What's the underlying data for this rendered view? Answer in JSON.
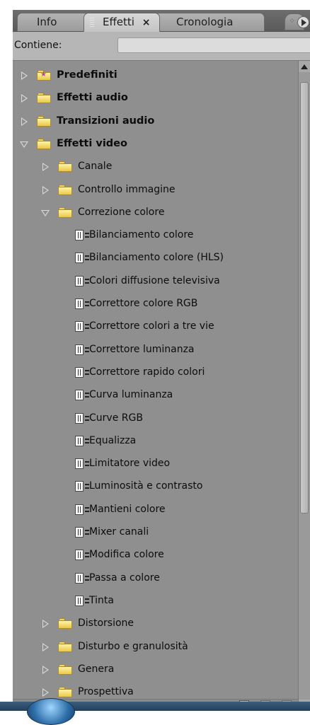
{
  "tabs": [
    {
      "label": "Info",
      "active": false
    },
    {
      "label": "Effetti",
      "active": true,
      "close": "×"
    },
    {
      "label": "Cronologia",
      "active": false
    }
  ],
  "search": {
    "label": "Contiene:",
    "value": ""
  },
  "tree": [
    {
      "label": "Predefiniti",
      "level": 0,
      "expander": "collapsed",
      "icon": "star-folder-icon",
      "bold": true
    },
    {
      "label": "Effetti audio",
      "level": 0,
      "expander": "collapsed",
      "icon": "folder-icon",
      "bold": true
    },
    {
      "label": "Transizioni audio",
      "level": 0,
      "expander": "collapsed",
      "icon": "folder-icon",
      "bold": true
    },
    {
      "label": "Effetti video",
      "level": 0,
      "expander": "expanded",
      "icon": "folder-icon",
      "bold": true
    },
    {
      "label": "Canale",
      "level": 1,
      "expander": "collapsed",
      "icon": "folder-icon"
    },
    {
      "label": "Controllo immagine",
      "level": 1,
      "expander": "collapsed",
      "icon": "folder-icon"
    },
    {
      "label": "Correzione colore",
      "level": 1,
      "expander": "expanded",
      "icon": "folder-icon"
    },
    {
      "label": "Bilanciamento colore",
      "level": 2,
      "icon": "effect-icon"
    },
    {
      "label": "Bilanciamento colore (HLS)",
      "level": 2,
      "icon": "effect-icon"
    },
    {
      "label": "Colori diffusione televisiva",
      "level": 2,
      "icon": "effect-icon"
    },
    {
      "label": "Correttore colore RGB",
      "level": 2,
      "icon": "effect-icon"
    },
    {
      "label": "Correttore colori a tre vie",
      "level": 2,
      "icon": "effect-icon"
    },
    {
      "label": "Correttore luminanza",
      "level": 2,
      "icon": "effect-icon"
    },
    {
      "label": "Correttore rapido colori",
      "level": 2,
      "icon": "effect-icon"
    },
    {
      "label": "Curva luminanza",
      "level": 2,
      "icon": "effect-icon"
    },
    {
      "label": "Curve RGB",
      "level": 2,
      "icon": "effect-icon"
    },
    {
      "label": "Equalizza",
      "level": 2,
      "icon": "effect-icon"
    },
    {
      "label": "Limitatore video",
      "level": 2,
      "icon": "effect-icon"
    },
    {
      "label": "Luminosità e contrasto",
      "level": 2,
      "icon": "effect-icon"
    },
    {
      "label": "Mantieni colore",
      "level": 2,
      "icon": "effect-icon"
    },
    {
      "label": "Mixer canali",
      "level": 2,
      "icon": "effect-icon"
    },
    {
      "label": "Modifica colore",
      "level": 2,
      "icon": "effect-icon"
    },
    {
      "label": "Passa a colore",
      "level": 2,
      "icon": "effect-icon"
    },
    {
      "label": "Tinta",
      "level": 2,
      "icon": "effect-icon"
    },
    {
      "label": "Distorsione",
      "level": 1,
      "expander": "collapsed",
      "icon": "folder-icon"
    },
    {
      "label": "Disturbo e granulosità",
      "level": 1,
      "expander": "collapsed",
      "icon": "folder-icon"
    },
    {
      "label": "Genera",
      "level": 1,
      "expander": "collapsed",
      "icon": "folder-icon"
    },
    {
      "label": "Prospettiva",
      "level": 1,
      "expander": "collapsed",
      "icon": "folder-icon"
    }
  ],
  "colors": {
    "panel_bg": "#8f8f8f",
    "tab_active": "#d0d0d0",
    "folder": "#f1d76a",
    "text": "#0c0c0c"
  }
}
